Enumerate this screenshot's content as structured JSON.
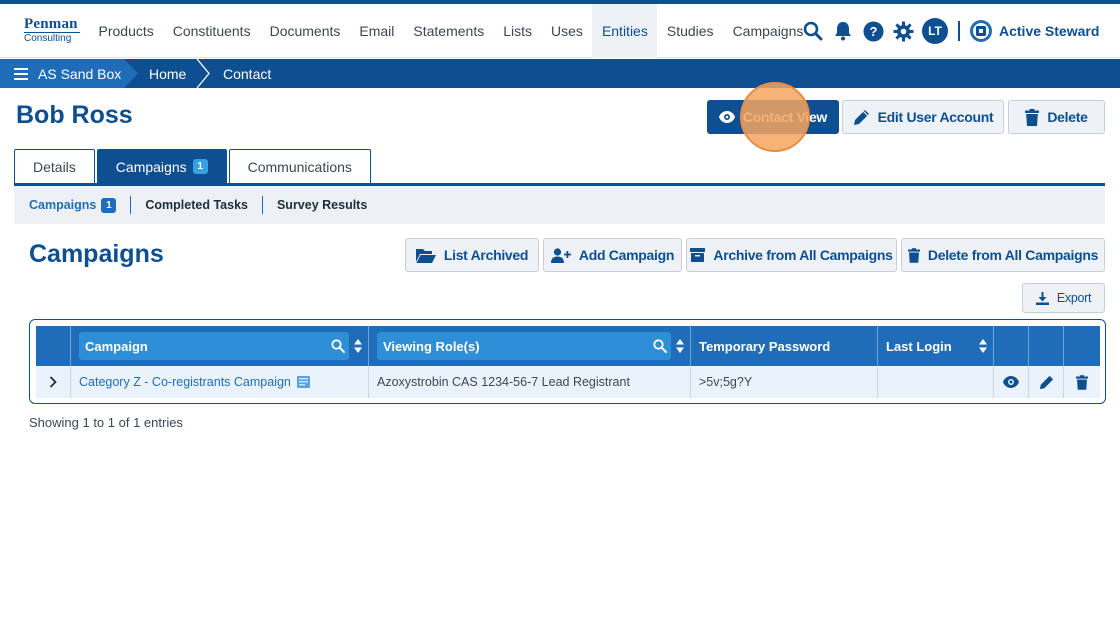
{
  "colors": {
    "primary": "#0d4f91",
    "accent": "#1f6db8",
    "highlight": "#f6a460"
  },
  "logo": {
    "line1": "Penman",
    "line2": "Consulting"
  },
  "nav": {
    "items": [
      {
        "label": "Products",
        "active": false
      },
      {
        "label": "Constituents",
        "active": false
      },
      {
        "label": "Documents",
        "active": false
      },
      {
        "label": "Email",
        "active": false
      },
      {
        "label": "Statements",
        "active": false
      },
      {
        "label": "Lists",
        "active": false
      },
      {
        "label": "Uses",
        "active": false
      },
      {
        "label": "Entities",
        "active": true
      },
      {
        "label": "Studies",
        "active": false
      },
      {
        "label": "Campaigns",
        "active": false
      }
    ],
    "icons": [
      "search-icon",
      "bell-icon",
      "help-icon",
      "gear-icon"
    ],
    "avatar_initials": "LT",
    "brand": "Active Steward"
  },
  "breadcrumb": {
    "root": "AS Sand Box",
    "home": "Home",
    "current": "Contact"
  },
  "page": {
    "title": "Bob Ross",
    "actions": {
      "contact_view": "Contact View",
      "edit_user": "Edit User Account",
      "delete": "Delete"
    }
  },
  "tabs": [
    {
      "label": "Details",
      "badge": ""
    },
    {
      "label": "Campaigns",
      "badge": "1"
    },
    {
      "label": "Communications",
      "badge": ""
    }
  ],
  "subtabs": [
    {
      "label": "Campaigns",
      "badge": "1"
    },
    {
      "label": "Completed Tasks",
      "badge": ""
    },
    {
      "label": "Survey Results",
      "badge": ""
    }
  ],
  "section": {
    "title": "Campaigns",
    "buttons": {
      "list_archived": "List Archived",
      "add_campaign": "Add Campaign",
      "archive_all": "Archive from All Campaigns",
      "delete_all": "Delete from All Campaigns",
      "export": "Export"
    }
  },
  "table": {
    "columns": {
      "campaign": "Campaign",
      "viewing_roles": "Viewing Role(s)",
      "temp_password": "Temporary Password",
      "last_login": "Last Login"
    },
    "rows": [
      {
        "campaign": "Category Z - Co-registrants Campaign",
        "viewing_roles": "Azoxystrobin CAS 1234-56-7 Lead Registrant",
        "temp_password": ">5v;5g?Y",
        "last_login": ""
      }
    ],
    "footer": "Showing 1 to 1 of 1 entries"
  }
}
